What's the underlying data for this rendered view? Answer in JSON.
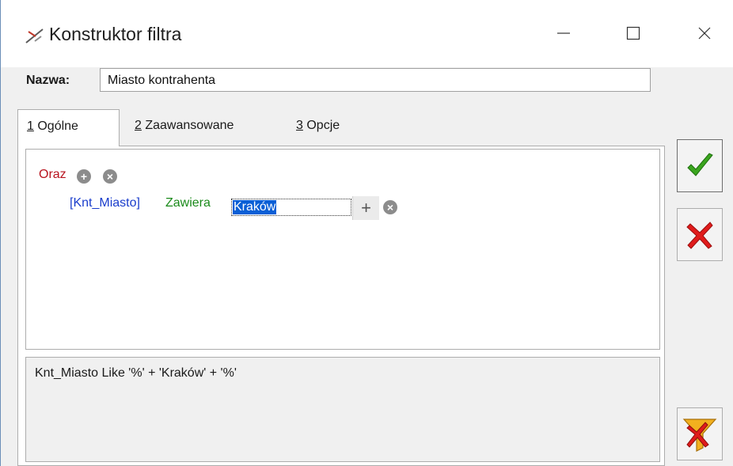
{
  "window": {
    "title": "Konstruktor filtra",
    "controls": {
      "minimize": "—",
      "maximize": "☐",
      "close": "✕"
    }
  },
  "name_field": {
    "label": "Nazwa:",
    "value": "Miasto kontrahenta"
  },
  "tabs": [
    {
      "key": "1",
      "rest": " Ogólne",
      "active": true
    },
    {
      "key": "2",
      "rest": " Zaawansowane",
      "active": false
    },
    {
      "key": "3",
      "rest": " Opcje",
      "active": false
    }
  ],
  "editor": {
    "group_operator": "Oraz",
    "condition": {
      "field": "[Knt_Miasto]",
      "operator": "Zawiera",
      "value": "Kraków"
    }
  },
  "preview": {
    "expression": "Knt_Miasto Like '%' + 'Kraków' + '%'"
  },
  "colors": {
    "group_operator": "#b8131e",
    "field": "#1a3dcc",
    "operator": "#1a8a1a",
    "selection": "#0a5fd6",
    "ok_check": "#3aa51e",
    "cancel_x": "#e01b1b"
  },
  "icons": {
    "app": "filter-wand-icon",
    "add_condition": "add-circle-icon",
    "remove": "remove-circle-icon",
    "add_value": "plus-icon",
    "ok": "checkmark-icon",
    "cancel": "red-x-icon",
    "clear_filter": "funnel-clear-icon"
  }
}
